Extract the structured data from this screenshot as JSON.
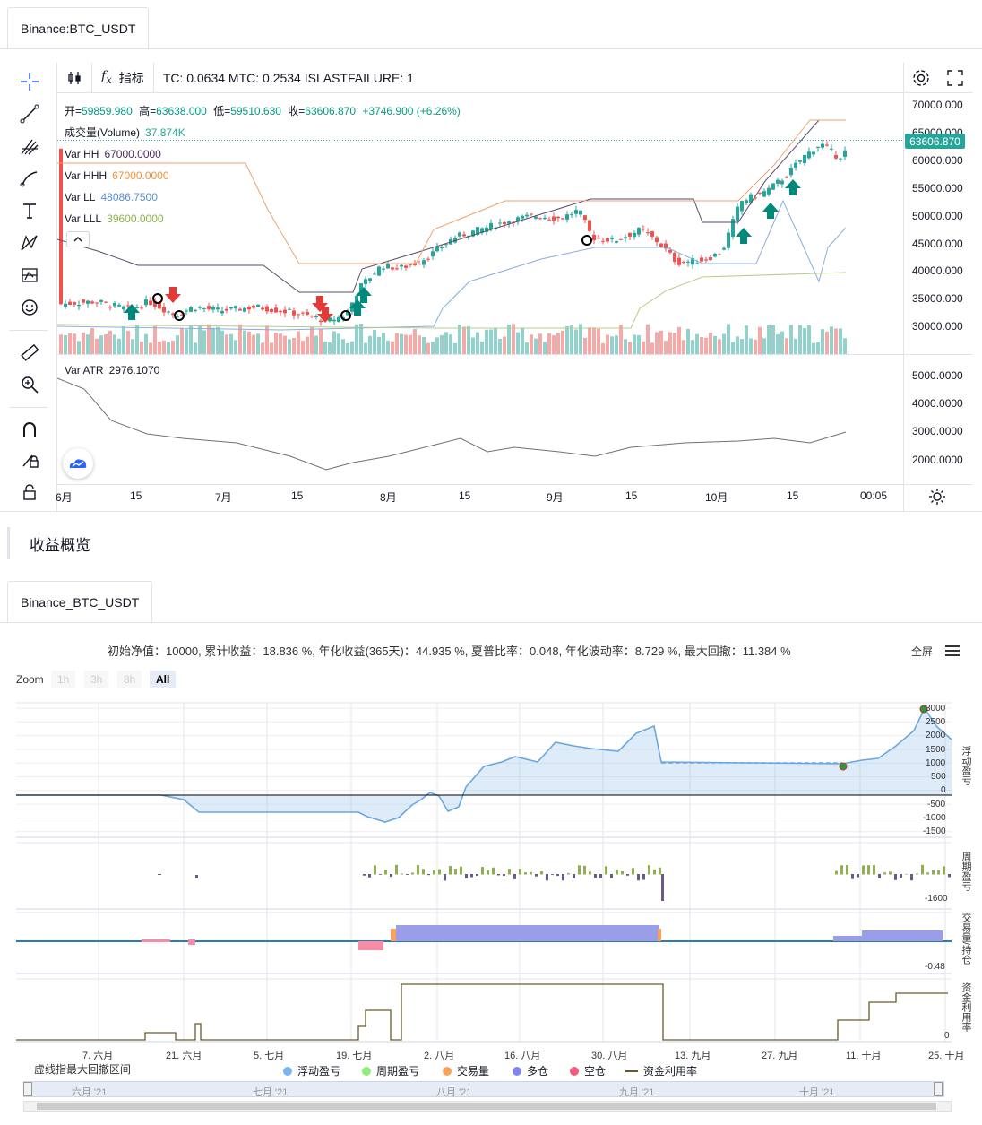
{
  "tab_top": "Binance:BTC_USDT",
  "toolbar": {
    "indicators_label": "指标",
    "strategy_params": "TC: 0.0634 MTC: 0.2534 ISLASTFAILURE: 1"
  },
  "ohlc": {
    "open_label": "开=",
    "open": "59859.980",
    "high_label": "高=",
    "high": "63638.000",
    "low_label": "低=",
    "low": "59510.630",
    "close_label": "收=",
    "close": "63606.870",
    "change": "+3746.900 (+6.26%)"
  },
  "legend": [
    {
      "name": "成交量(Volume)",
      "value": "37.874K",
      "color": "#26a69a"
    },
    {
      "name": "Var HH",
      "value": "67000.0000",
      "color": "#4a2a5a"
    },
    {
      "name": "Var HHH",
      "value": "67000.0000",
      "color": "#f0913a"
    },
    {
      "name": "Var LL",
      "value": "48086.7500",
      "color": "#5b8fd6"
    },
    {
      "name": "Var LLL",
      "value": "39600.0000",
      "color": "#8bb34a"
    }
  ],
  "atr_legend": {
    "name": "Var ATR",
    "value": "2976.1070"
  },
  "price_axis": [
    "70000.000",
    "65000.000",
    "60000.000",
    "55000.000",
    "50000.000",
    "45000.000",
    "40000.000",
    "35000.000",
    "30000.000"
  ],
  "last_price": "63606.870",
  "atr_axis": [
    "5000.0000",
    "4000.0000",
    "3000.0000",
    "2000.0000"
  ],
  "time_axis": [
    "6月",
    "15",
    "7月",
    "15",
    "8月",
    "15",
    "9月",
    "15",
    "10月",
    "15",
    "00:05"
  ],
  "section_title": "收益概览",
  "tab_bottom": "Binance_BTC_USDT",
  "stats": "初始净值：10000, 累计收益：18.836 %, 年化收益(365天)：44.935 %, 夏普比率：0.048, 年化波动率：8.729 %, 最大回撤：11.384 %",
  "fullscreen_label": "全屏",
  "zoom": {
    "label": "Zoom",
    "buttons": [
      "1h",
      "3h",
      "8h",
      "All"
    ]
  },
  "pnl_axis": [
    "3000",
    "2500",
    "2000",
    "1500",
    "1000",
    "500",
    "0",
    "-500",
    "-1000",
    "-1500"
  ],
  "period_axis": [
    "-1600"
  ],
  "trade_axis": [
    "-0.48"
  ],
  "util_axis": [
    "0"
  ],
  "pane_labels": [
    "浮动盈亏",
    "周期盈亏",
    "交易量/持仓",
    "资金利用率"
  ],
  "date_axis": [
    "7. 六月",
    "21. 六月",
    "5. 七月",
    "19. 七月",
    "2. 八月",
    "16. 八月",
    "30. 八月",
    "13. 九月",
    "27. 九月",
    "11. 十月",
    "25. 十月"
  ],
  "drawdown_label": "虚线指最大回撤区间",
  "legend_bottom": [
    {
      "name": "浮动盈亏",
      "color": "#7cb5ec",
      "type": "dot"
    },
    {
      "name": "周期盈亏",
      "color": "#90ed7d",
      "type": "dot"
    },
    {
      "name": "交易量",
      "color": "#f7a35c",
      "type": "dot"
    },
    {
      "name": "多仓",
      "color": "#8085e9",
      "type": "dot"
    },
    {
      "name": "空仓",
      "color": "#f15c80",
      "type": "dot"
    },
    {
      "name": "资金利用率",
      "color": "#6b5a2a",
      "type": "line"
    }
  ],
  "navigator_labels": [
    "六月 '21",
    "七月 '21",
    "八月 '21",
    "九月 '21",
    "十月 '21"
  ]
}
